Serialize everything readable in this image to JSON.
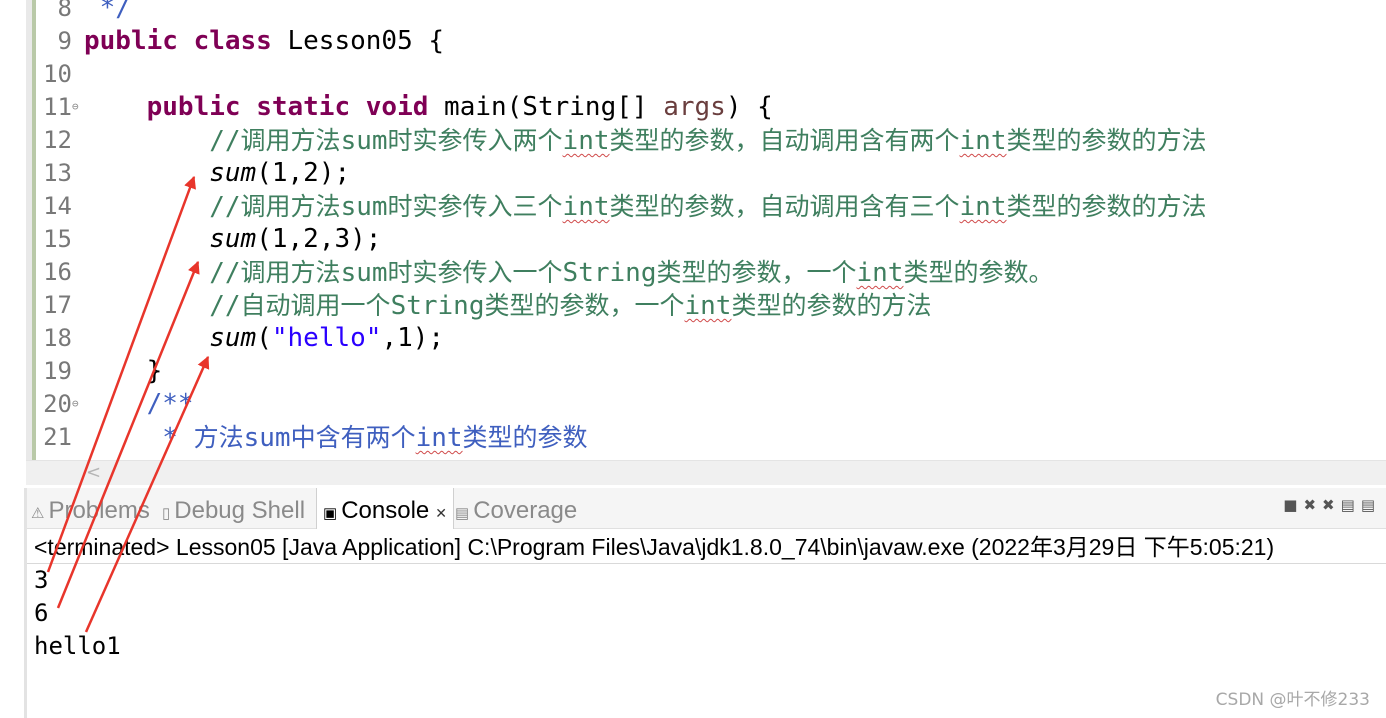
{
  "editor": {
    "lines": [
      {
        "num": "8",
        "fold": "",
        "tokens": [
          {
            "t": " */",
            "c": "cmd"
          }
        ]
      },
      {
        "num": "9",
        "fold": "",
        "tokens": [
          {
            "t": "public class",
            "c": "kw"
          },
          {
            "t": " Lesson05 {",
            "c": ""
          }
        ]
      },
      {
        "num": "10",
        "fold": "",
        "tokens": []
      },
      {
        "num": "11",
        "fold": "⊖",
        "tokens": [
          {
            "t": "    ",
            "c": ""
          },
          {
            "t": "public static void",
            "c": "kw"
          },
          {
            "t": " main(String[] ",
            "c": ""
          },
          {
            "t": "args",
            "c": "par"
          },
          {
            "t": ") {",
            "c": ""
          }
        ]
      },
      {
        "num": "12",
        "fold": "",
        "tokens": [
          {
            "t": "        //",
            "c": "cm"
          },
          {
            "t": "调用方法",
            "c": "cm cjk"
          },
          {
            "t": "sum",
            "c": "cm"
          },
          {
            "t": "时实参传入两个",
            "c": "cm cjk"
          },
          {
            "t": "int",
            "c": "cm squig"
          },
          {
            "t": "类型的参数，自动调用含有两个",
            "c": "cm cjk"
          },
          {
            "t": "int",
            "c": "cm squig"
          },
          {
            "t": "类型的参数的方法",
            "c": "cm cjk"
          }
        ]
      },
      {
        "num": "13",
        "fold": "",
        "tokens": [
          {
            "t": "        ",
            "c": ""
          },
          {
            "t": "sum",
            "c": "it"
          },
          {
            "t": "(1,2);",
            "c": ""
          }
        ]
      },
      {
        "num": "14",
        "fold": "",
        "tokens": [
          {
            "t": "        //",
            "c": "cm"
          },
          {
            "t": "调用方法",
            "c": "cm cjk"
          },
          {
            "t": "sum",
            "c": "cm"
          },
          {
            "t": "时实参传入三个",
            "c": "cm cjk"
          },
          {
            "t": "int",
            "c": "cm squig"
          },
          {
            "t": "类型的参数，自动调用含有三个",
            "c": "cm cjk"
          },
          {
            "t": "int",
            "c": "cm squig"
          },
          {
            "t": "类型的参数的方法",
            "c": "cm cjk"
          }
        ]
      },
      {
        "num": "15",
        "fold": "",
        "tokens": [
          {
            "t": "        ",
            "c": ""
          },
          {
            "t": "sum",
            "c": "it"
          },
          {
            "t": "(1,2,3);",
            "c": ""
          }
        ]
      },
      {
        "num": "16",
        "fold": "",
        "tokens": [
          {
            "t": "        //",
            "c": "cm"
          },
          {
            "t": "调用方法",
            "c": "cm cjk"
          },
          {
            "t": "sum",
            "c": "cm"
          },
          {
            "t": "时实参传入一个",
            "c": "cm cjk"
          },
          {
            "t": "String",
            "c": "cm"
          },
          {
            "t": "类型的参数，一个",
            "c": "cm cjk"
          },
          {
            "t": "int",
            "c": "cm squig"
          },
          {
            "t": "类型的参数。",
            "c": "cm cjk"
          }
        ]
      },
      {
        "num": "17",
        "fold": "",
        "tokens": [
          {
            "t": "        //",
            "c": "cm"
          },
          {
            "t": "自动调用一个",
            "c": "cm cjk"
          },
          {
            "t": "String",
            "c": "cm"
          },
          {
            "t": "类型的参数，一个",
            "c": "cm cjk"
          },
          {
            "t": "int",
            "c": "cm squig"
          },
          {
            "t": "类型的参数的方法",
            "c": "cm cjk"
          }
        ]
      },
      {
        "num": "18",
        "fold": "",
        "tokens": [
          {
            "t": "        ",
            "c": ""
          },
          {
            "t": "sum",
            "c": "it"
          },
          {
            "t": "(",
            "c": ""
          },
          {
            "t": "\"hello\"",
            "c": "str"
          },
          {
            "t": ",1);",
            "c": ""
          }
        ]
      },
      {
        "num": "19",
        "fold": "",
        "tokens": [
          {
            "t": "    }",
            "c": ""
          }
        ]
      },
      {
        "num": "20",
        "fold": "⊖",
        "tokens": [
          {
            "t": "    /**",
            "c": "cmd"
          }
        ]
      },
      {
        "num": "21",
        "fold": "",
        "tokens": [
          {
            "t": "     * ",
            "c": "cmd"
          },
          {
            "t": "方法",
            "c": "cmd cjk"
          },
          {
            "t": "sum",
            "c": "cmd"
          },
          {
            "t": "中含有两个",
            "c": "cmd cjk"
          },
          {
            "t": "int",
            "c": "cmd squig"
          },
          {
            "t": "类型的参数",
            "c": "cmd cjk"
          }
        ]
      }
    ]
  },
  "console_panel": {
    "tabs": [
      {
        "icon": "⚠",
        "label": "Problems",
        "active": false
      },
      {
        "icon": "▯",
        "label": "Debug Shell",
        "active": false
      },
      {
        "icon": "▣",
        "label": "Console",
        "active": true,
        "close": "✕"
      },
      {
        "icon": "▤",
        "label": "Coverage",
        "active": false
      }
    ],
    "toolbar_icons": [
      "■",
      "✖",
      "✖",
      "▤",
      "▤"
    ],
    "terminated_line": "<terminated> Lesson05 [Java Application] C:\\Program Files\\Java\\jdk1.8.0_74\\bin\\javaw.exe (2022年3月29日 下午5:05:21)",
    "output": [
      "3",
      "6",
      "hello1"
    ]
  },
  "hscroll_arrow": "<",
  "watermark": "CSDN @叶不修233",
  "colors": {
    "annotation_arrow": "#e8352b",
    "keyword": "#7f0055",
    "comment": "#3f7f5f",
    "javadoc": "#3f5fbf",
    "string": "#2a00ff"
  }
}
